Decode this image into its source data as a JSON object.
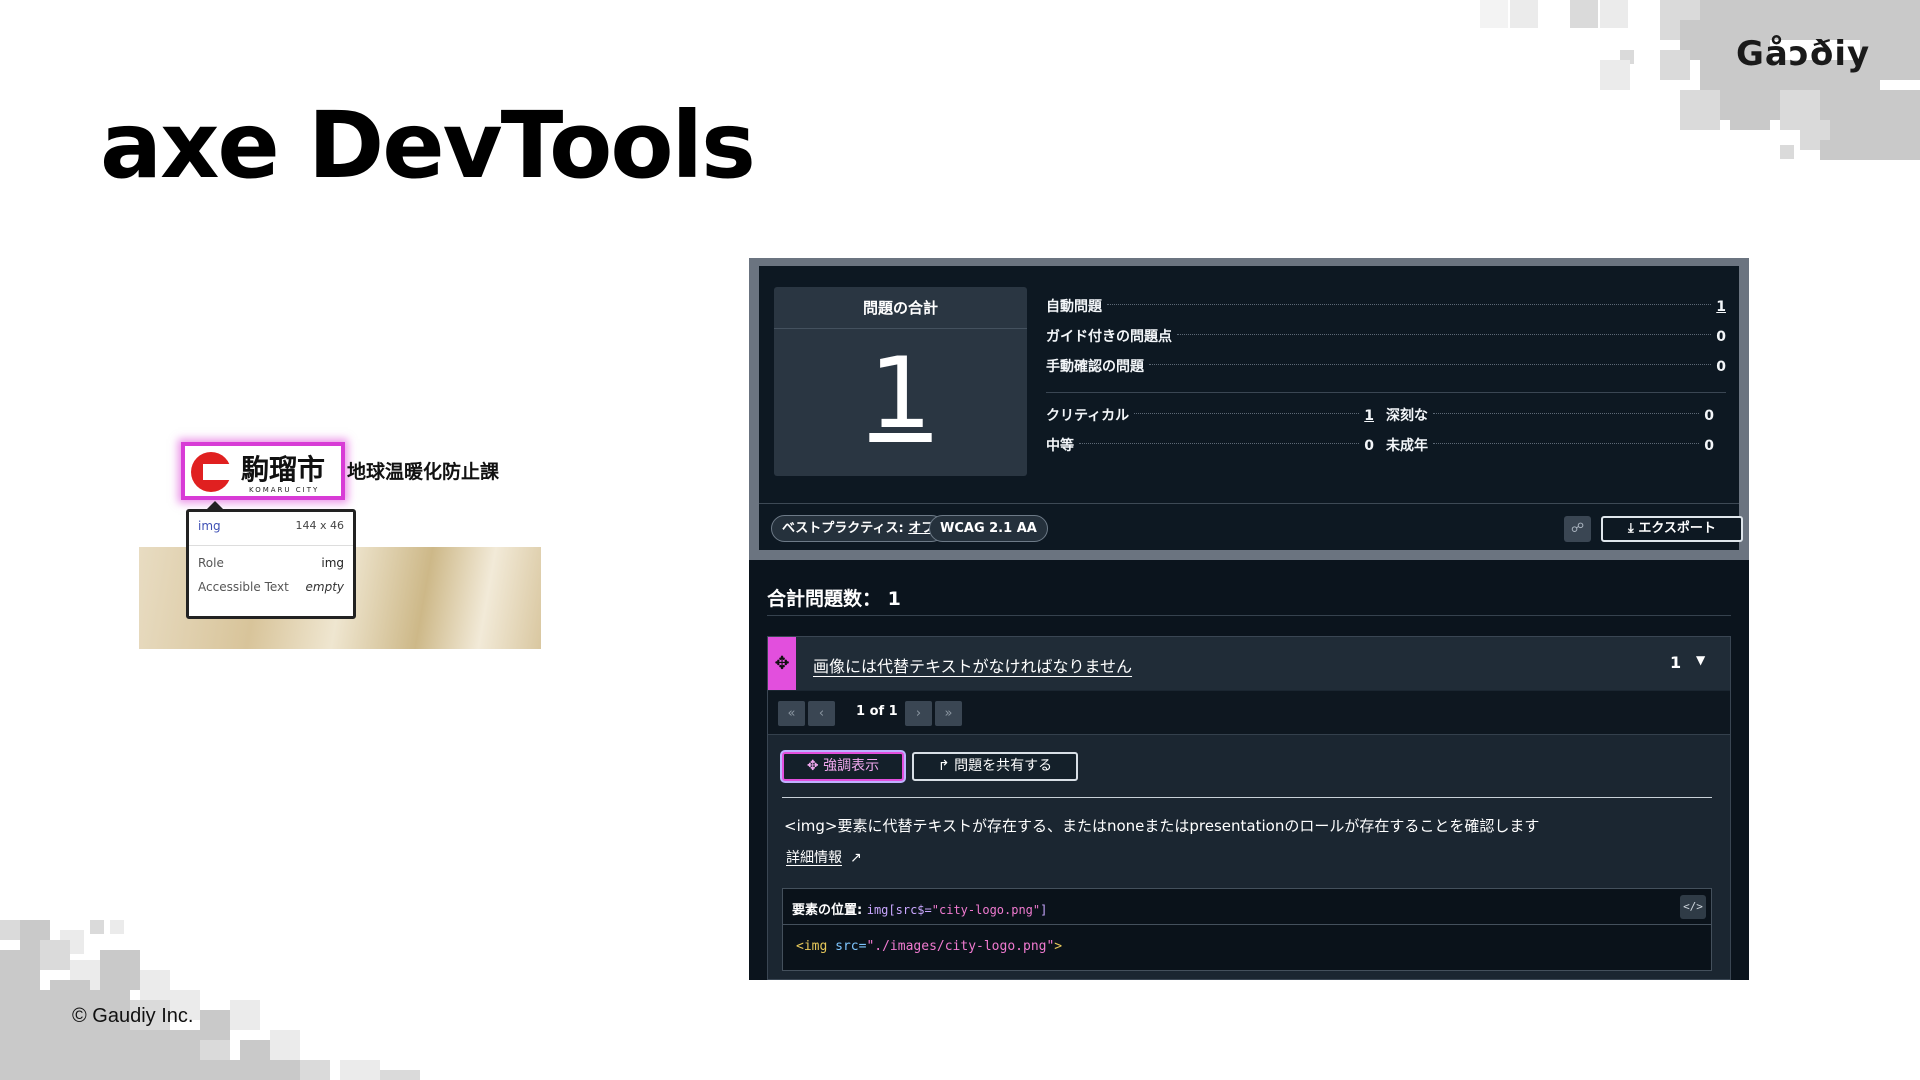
{
  "slide": {
    "title": "axe DevTools",
    "brand": "Gåɔðiy",
    "copyright": "© Gaudiy Inc."
  },
  "illustration": {
    "city_name_jp": "駒瑠市",
    "city_name_en": "KOMARU CITY",
    "department": "地球温暖化防止課",
    "tooltip": {
      "tag": "img",
      "size": "144 x 46",
      "role_label": "Role",
      "role_value": "img",
      "acc_label": "Accessible Text",
      "acc_value": "empty"
    }
  },
  "axe": {
    "total_label": "問題の合計",
    "total_value": "1",
    "stats": [
      {
        "label": "自動問題",
        "value": "1"
      },
      {
        "label": "ガイド付きの問題点",
        "value": "0"
      },
      {
        "label": "手動確認の問題",
        "value": "0"
      }
    ],
    "severity": [
      {
        "label": "クリティカル",
        "value": "1"
      },
      {
        "label": "深刻な",
        "value": "0"
      },
      {
        "label": "中等",
        "value": "0"
      },
      {
        "label": "未成年",
        "value": "0"
      }
    ],
    "best_practice_label": "ベストプラクティス:",
    "best_practice_value": "オフ",
    "wcag_label": "WCAG 2.1 AA",
    "export_label": "⤓ エクスポート",
    "issues_total_label": "合計問題数：",
    "issues_total_value": "1",
    "issue": {
      "title": "画像には代替テキストがなければなりません",
      "count": "1",
      "pager_text": "1 of 1",
      "highlight_label": "✥ 強調表示",
      "share_label": "↱ 問題を共有する",
      "description": "<img>要素に代替テキストが存在する、またはnoneまたはpresentationのロールが存在することを確認します",
      "more_info": "詳細情報",
      "location_label": "要素の位置:",
      "selector_prefix": "img[src$=",
      "selector_str": "\"city-logo.png\"",
      "selector_suffix": "]",
      "snippet_tag_open": "<img ",
      "snippet_attr": "src=",
      "snippet_str": "\"./images/city-logo.png\"",
      "snippet_tag_close": ">"
    }
  },
  "colors": {
    "highlight_magenta": "#e24fdd",
    "panel_dark": "#0b141d"
  }
}
